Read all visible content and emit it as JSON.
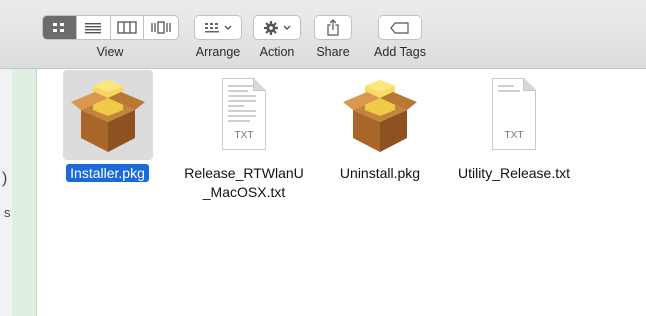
{
  "toolbar": {
    "view_label": "View",
    "arrange_label": "Arrange",
    "action_label": "Action",
    "share_label": "Share",
    "add_tags_label": "Add Tags",
    "view_buttons": [
      "icon-view-icon",
      "list-view-icon",
      "column-view-icon",
      "cover-flow-icon"
    ]
  },
  "files": [
    {
      "name": "Installer.pkg",
      "type": "pkg",
      "selected": true
    },
    {
      "name": "Release_RTWlanU\n_MacOSX.txt",
      "name_line1": "Release_RTWlanU",
      "name_line2": "_MacOSX.txt",
      "type": "txt",
      "tag": "TXT"
    },
    {
      "name": "Uninstall.pkg",
      "type": "pkg"
    },
    {
      "name": "Utility_Release.txt",
      "type": "txt",
      "tag": "TXT"
    }
  ],
  "colors": {
    "selection": "#1a6ad7",
    "sidebar": "#dff0e2"
  }
}
